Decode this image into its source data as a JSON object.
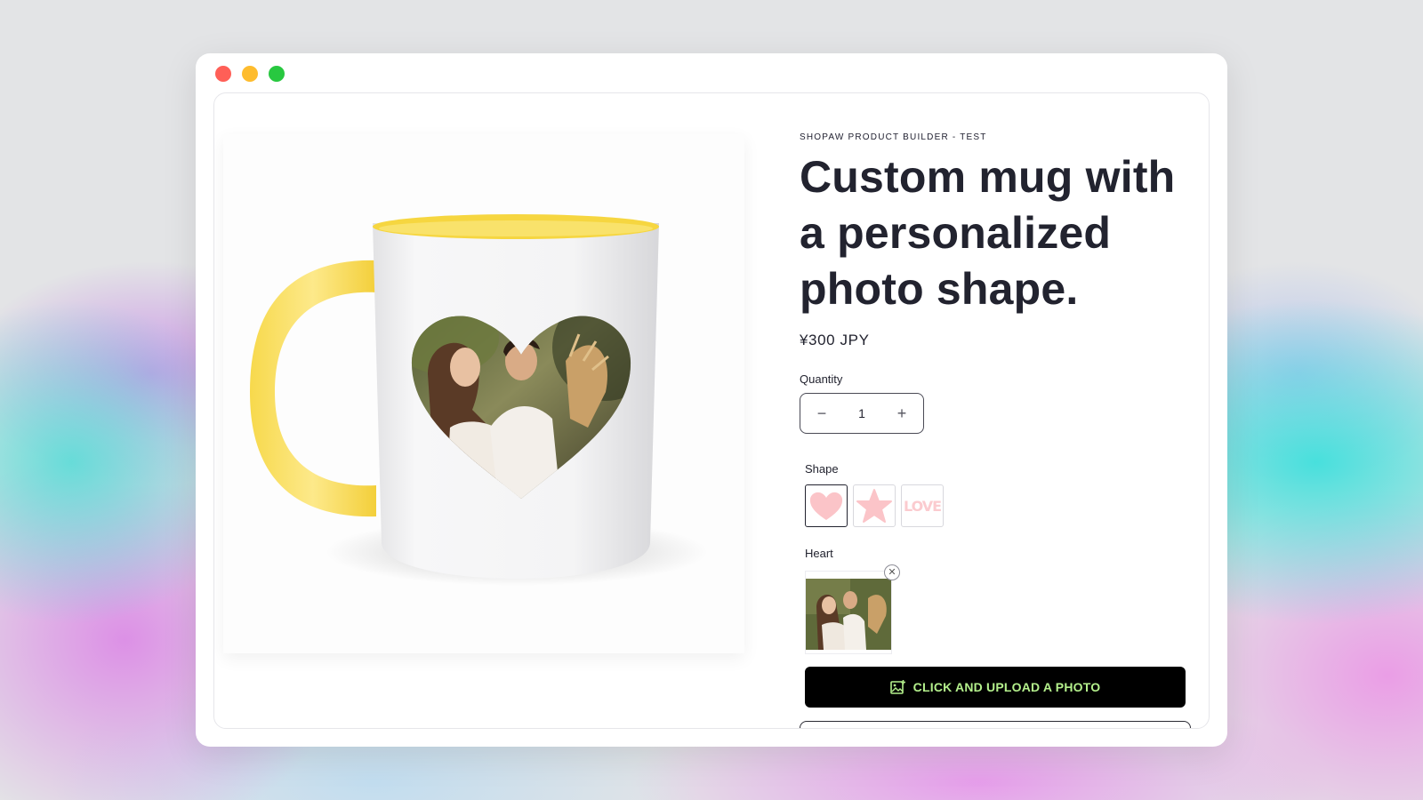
{
  "window": {
    "controls": [
      "close",
      "minimize",
      "maximize"
    ],
    "colors": {
      "close": "#ff5f57",
      "minimize": "#febc2e",
      "maximize": "#28c840"
    }
  },
  "product": {
    "vendor": "SHOPAW PRODUCT BUILDER - TEST",
    "title": "Custom mug with a personalized photo shape.",
    "price": "¥300 JPY",
    "image_icon": "mug-with-heart-photo",
    "mug_accent_color": "#f8dd56"
  },
  "quantity": {
    "label": "Quantity",
    "value": "1",
    "decrease_icon": "minus-icon",
    "increase_icon": "plus-icon"
  },
  "shape": {
    "label": "Shape",
    "options": [
      {
        "name": "heart",
        "icon": "heart-icon",
        "selected": true
      },
      {
        "name": "star",
        "icon": "star-icon",
        "selected": false
      },
      {
        "name": "love",
        "text": "LOVE",
        "selected": false
      }
    ],
    "swatch_color": "#fbc4c8"
  },
  "selected_shape": {
    "label": "Heart",
    "remove_icon": "close-icon"
  },
  "upload": {
    "label": "CLICK AND UPLOAD A PHOTO",
    "icon": "image-upload-icon",
    "background": "#000000",
    "text_color": "#b4f08c"
  }
}
